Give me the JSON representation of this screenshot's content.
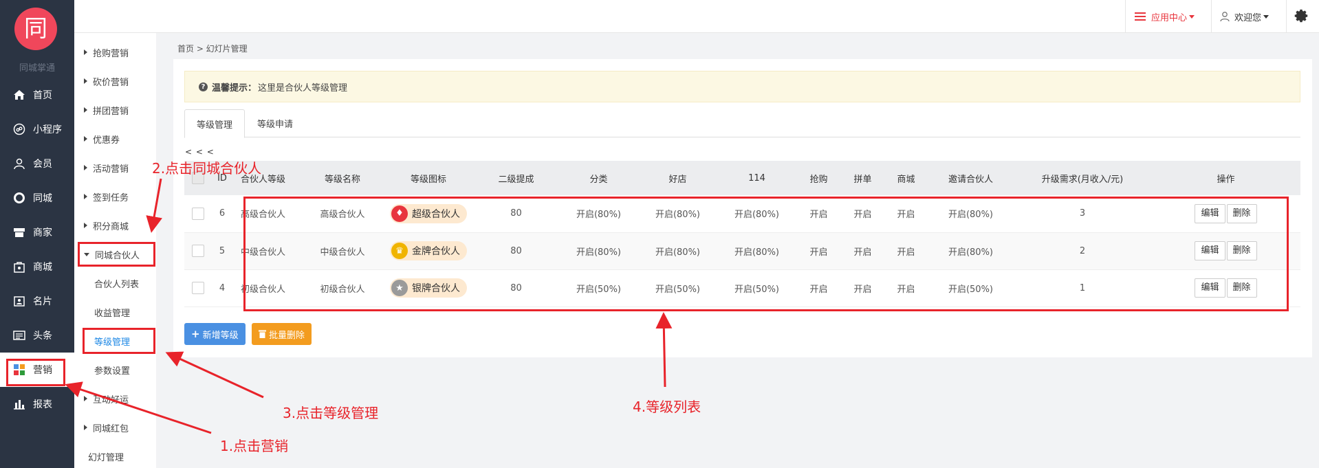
{
  "brand": {
    "logo_char": "同",
    "name": "同城掌通"
  },
  "main_nav": [
    {
      "label": "首页",
      "icon": "home-icon"
    },
    {
      "label": "小程序",
      "icon": "miniapp-icon"
    },
    {
      "label": "会员",
      "icon": "user-icon"
    },
    {
      "label": "同城",
      "icon": "ring-icon"
    },
    {
      "label": "商家",
      "icon": "store-icon"
    },
    {
      "label": "商城",
      "icon": "mall-icon"
    },
    {
      "label": "名片",
      "icon": "card-icon"
    },
    {
      "label": "头条",
      "icon": "news-icon"
    },
    {
      "label": "营销",
      "icon": "marketing-icon"
    },
    {
      "label": "报表",
      "icon": "report-icon"
    }
  ],
  "sub_nav": [
    "抢购营销",
    "砍价营销",
    "拼团营销",
    "优惠券",
    "活动营销",
    "签到任务",
    "积分商城",
    "同城合伙人",
    "合伙人列表",
    "收益管理",
    "等级管理",
    "参数设置",
    "互动好运",
    "同城红包",
    "幻灯管理"
  ],
  "header": {
    "app_center": "应用中心",
    "welcome": "欢迎您"
  },
  "breadcrumb": "首页 > 幻灯片管理",
  "tip": {
    "title": "温馨提示：",
    "text": "这里是合伙人等级管理"
  },
  "tabs": [
    "等级管理",
    "等级申请"
  ],
  "pager": "< < <",
  "table": {
    "headers": [
      "ID",
      "合伙人等级",
      "等级名称",
      "等级图标",
      "二级提成",
      "分类",
      "好店",
      "114",
      "抢购",
      "拼单",
      "商城",
      "邀请合伙人",
      "升级需求(月收入/元)",
      "操作"
    ],
    "rows": [
      {
        "id": "6",
        "level": "高级合伙人",
        "name": "高级合伙人",
        "icon_label": "超级合伙人",
        "icon_color": "#e8353d",
        "commission": "80",
        "category": "开启(80%)",
        "shop": "开启(80%)",
        "c114": "开启(80%)",
        "flash": "开启",
        "group": "开启",
        "mall": "开启",
        "invite": "开启(80%)",
        "upgrade": "3"
      },
      {
        "id": "5",
        "level": "中级合伙人",
        "name": "中级合伙人",
        "icon_label": "金牌合伙人",
        "icon_color": "#f0b400",
        "commission": "80",
        "category": "开启(80%)",
        "shop": "开启(80%)",
        "c114": "开启(80%)",
        "flash": "开启",
        "group": "开启",
        "mall": "开启",
        "invite": "开启(80%)",
        "upgrade": "2"
      },
      {
        "id": "4",
        "level": "初级合伙人",
        "name": "初级合伙人",
        "icon_label": "银牌合伙人",
        "icon_color": "#9a9a9a",
        "commission": "80",
        "category": "开启(50%)",
        "shop": "开启(50%)",
        "c114": "开启(50%)",
        "flash": "开启",
        "group": "开启",
        "mall": "开启",
        "invite": "开启(50%)",
        "upgrade": "1"
      }
    ],
    "edit_label": "编辑",
    "delete_label": "删除"
  },
  "actions": {
    "add_label": "新增等级",
    "batch_delete_label": "批量删除"
  },
  "annotations": [
    "2.点击同城合伙人",
    "3.点击等级管理",
    "4.等级列表",
    "1.点击营销"
  ],
  "colors": {
    "sidebar": "#2b3443",
    "brand": "#f0475b",
    "annotation": "#e8232a",
    "enabled": "#2e9b3a"
  }
}
